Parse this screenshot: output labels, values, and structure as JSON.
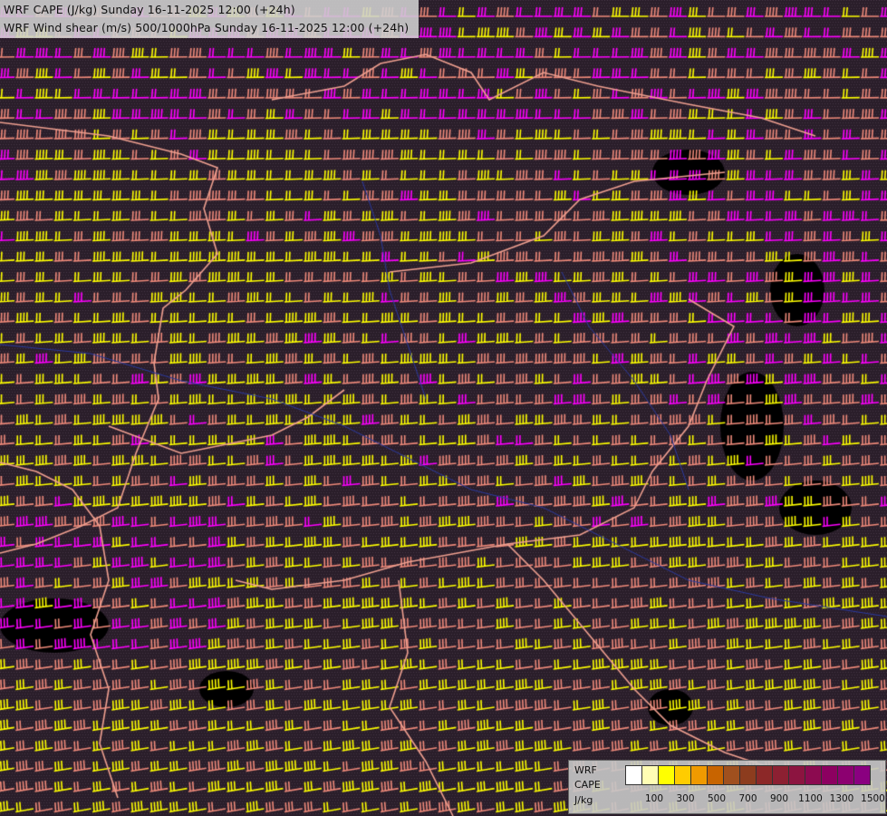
{
  "title_line1": "WRF CAPE (J/kg) Sunday 16-11-2025 12:00 (+24h)",
  "title_line2": "WRF Wind shear (m/s) 500/1000hPa Sunday 16-11-2025 12:00 (+24h)",
  "legend": {
    "label1": "WRF",
    "label2": "CAPE",
    "label3": "J/kg",
    "colors": [
      "#ffffff",
      "#fffdb4",
      "#ffff00",
      "#ffcc00",
      "#f09a00",
      "#c86400",
      "#a0501e",
      "#8c3c1e",
      "#8c2828",
      "#8c2032",
      "#8c1440",
      "#8c0a50",
      "#8c0060",
      "#8c0070",
      "#8a0080"
    ],
    "ticks": [
      "100",
      "300",
      "500",
      "700",
      "900",
      "1100",
      "1300",
      "1500"
    ]
  },
  "map_style": {
    "background": "#2a1e2a",
    "shear_colors": {
      "low": "#ffff00",
      "mid": "#f08a7a",
      "high": "#ff00ff"
    },
    "border_color": "#f0a090",
    "river_color": "#2a3aa0"
  }
}
